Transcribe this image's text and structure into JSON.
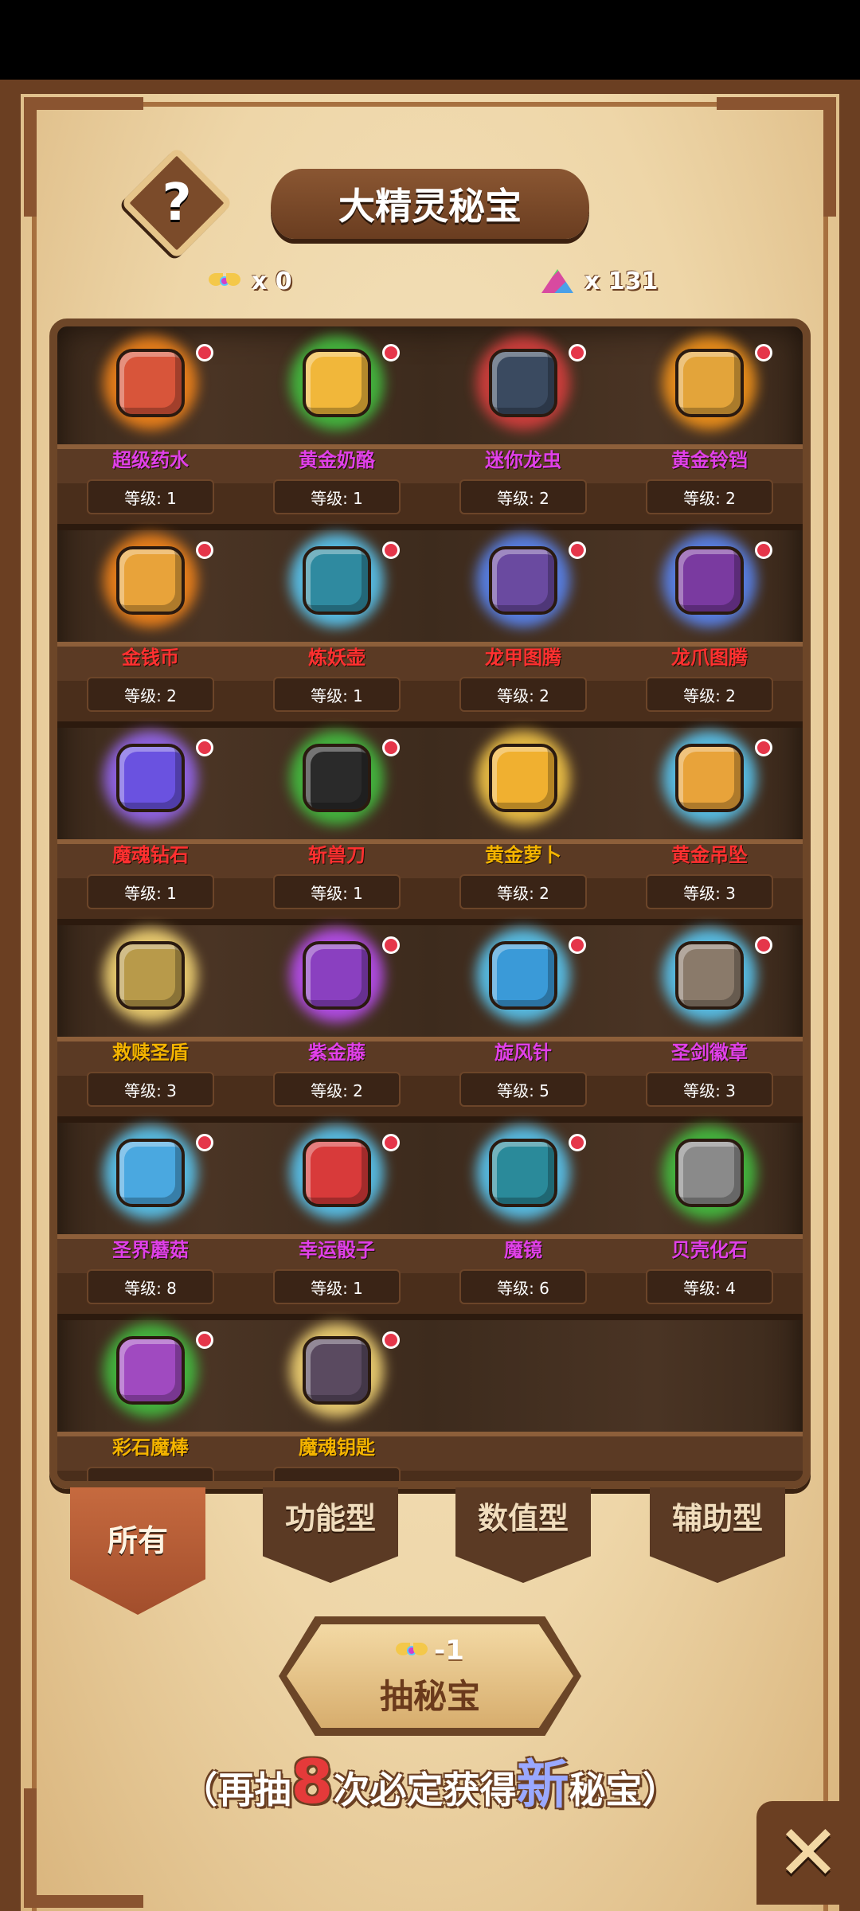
{
  "title": "大精灵秘宝",
  "help_label": "?",
  "currency": {
    "tickets_label": "x 0",
    "gems_label": "x 131"
  },
  "items": [
    {
      "name": "超级药水",
      "level": "等级: 1",
      "color": "#e040e8",
      "glow": "#ff8a1a",
      "fill": "#d8553a",
      "new": true
    },
    {
      "name": "黄金奶酪",
      "level": "等级: 1",
      "color": "#e040e8",
      "glow": "#43c842",
      "fill": "#f1b73a",
      "new": true
    },
    {
      "name": "迷你龙虫",
      "level": "等级: 2",
      "color": "#e040e8",
      "glow": "#e04040",
      "fill": "#3a4a60",
      "new": true
    },
    {
      "name": "黄金铃铛",
      "level": "等级: 2",
      "color": "#e040e8",
      "glow": "#ff9a1a",
      "fill": "#e3a43a",
      "new": true
    },
    {
      "name": "金钱币",
      "level": "等级: 2",
      "color": "#ff3030",
      "glow": "#ff8a1a",
      "fill": "#e8a33a",
      "new": true
    },
    {
      "name": "炼妖壶",
      "level": "等级: 1",
      "color": "#ff3030",
      "glow": "#5ad0ff",
      "fill": "#2f8aa0",
      "new": true
    },
    {
      "name": "龙甲图腾",
      "level": "等级: 2",
      "color": "#ff3030",
      "glow": "#5a8aff",
      "fill": "#6a4aa0",
      "new": true
    },
    {
      "name": "龙爪图腾",
      "level": "等级: 2",
      "color": "#ff3030",
      "glow": "#5a8aff",
      "fill": "#7a3aa0",
      "new": true
    },
    {
      "name": "魔魂钻石",
      "level": "等级: 1",
      "color": "#ff3030",
      "glow": "#9a6aff",
      "fill": "#6a52e0",
      "new": true
    },
    {
      "name": "斩兽刀",
      "level": "等级: 1",
      "color": "#ff3030",
      "glow": "#43c842",
      "fill": "#2a2a2a",
      "new": true
    },
    {
      "name": "黄金萝卜",
      "level": "等级: 2",
      "color": "#f4b400",
      "glow": "#ffd04a",
      "fill": "#f0b030",
      "new": false
    },
    {
      "name": "黄金吊坠",
      "level": "等级: 3",
      "color": "#ff3030",
      "glow": "#5ad0ff",
      "fill": "#e8a33a",
      "new": true
    },
    {
      "name": "救赎圣盾",
      "level": "等级: 3",
      "color": "#f4b400",
      "glow": "#ffe07a",
      "fill": "#b89a4a",
      "new": false
    },
    {
      "name": "紫金藤",
      "level": "等级: 2",
      "color": "#e040e8",
      "glow": "#c050ff",
      "fill": "#8a40c0",
      "new": true
    },
    {
      "name": "旋风针",
      "level": "等级: 5",
      "color": "#e040e8",
      "glow": "#5ad0ff",
      "fill": "#3a9ad8",
      "new": true
    },
    {
      "name": "圣剑徽章",
      "level": "等级: 3",
      "color": "#e040e8",
      "glow": "#5ad0ff",
      "fill": "#8a7a6a",
      "new": true
    },
    {
      "name": "圣界蘑菇",
      "level": "等级: 8",
      "color": "#e040e8",
      "glow": "#5ad0ff",
      "fill": "#4aa8e0",
      "new": true
    },
    {
      "name": "幸运骰子",
      "level": "等级: 1",
      "color": "#e040e8",
      "glow": "#5ad0ff",
      "fill": "#d83a3a",
      "new": true
    },
    {
      "name": "魔镜",
      "level": "等级: 6",
      "color": "#e040e8",
      "glow": "#5ad0ff",
      "fill": "#2a8a9a",
      "new": true
    },
    {
      "name": "贝壳化石",
      "level": "等级: 4",
      "color": "#e040e8",
      "glow": "#43c842",
      "fill": "#8a8a8a",
      "new": false
    },
    {
      "name": "彩石魔棒",
      "level": "",
      "color": "#f4b400",
      "glow": "#43c842",
      "fill": "#a04ac0",
      "new": true
    },
    {
      "name": "魔魂钥匙",
      "level": "",
      "color": "#f4b400",
      "glow": "#ffe07a",
      "fill": "#5a4a60",
      "new": true
    }
  ],
  "tabs": [
    {
      "label": "所有",
      "active": true
    },
    {
      "label": "功能型",
      "active": false
    },
    {
      "label": "数值型",
      "active": false
    },
    {
      "label": "辅助型",
      "active": false
    }
  ],
  "draw": {
    "cost": "-1",
    "label": "抽秘宝"
  },
  "hint": {
    "prefix": "（再抽",
    "count": "8",
    "middle": "次必定获得",
    "highlight": "新",
    "suffix": "秘宝）"
  },
  "close_label": "✕"
}
